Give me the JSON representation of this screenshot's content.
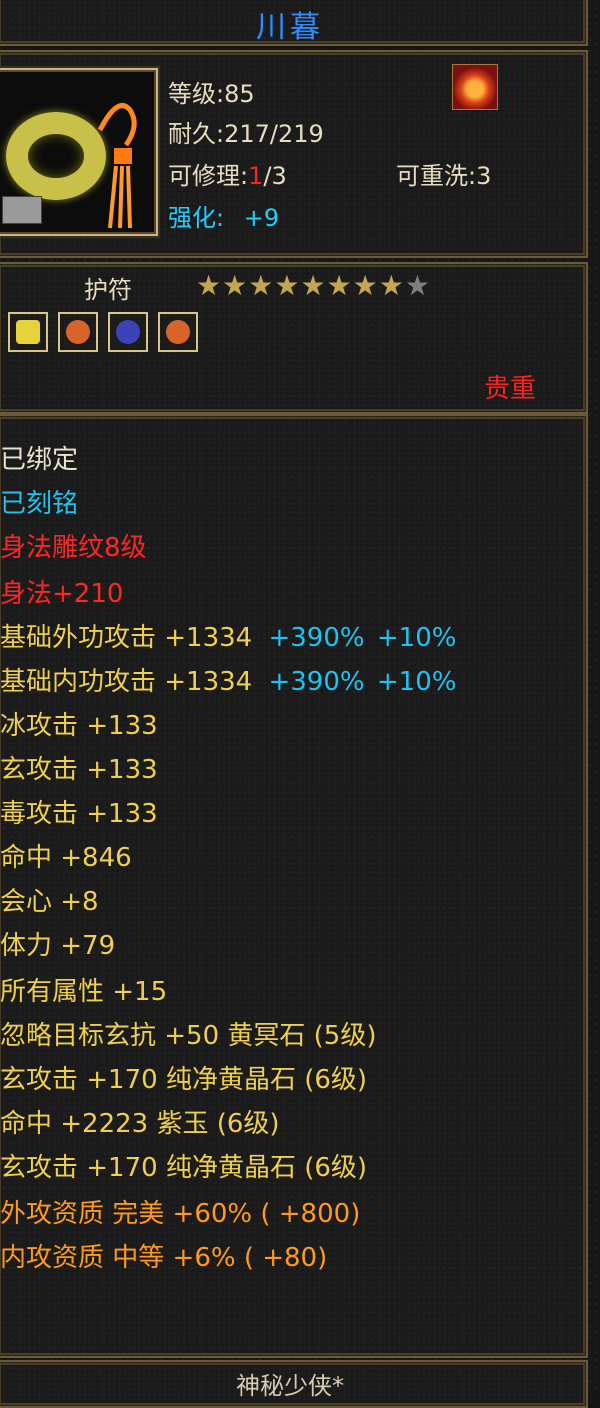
{
  "item": {
    "name": "川暮",
    "type": "护符",
    "rarity": "贵重",
    "level_label": "等级:85",
    "durability_label": "耐久:217/219",
    "repair_prefix": "可修理:",
    "repair_current": "1",
    "repair_suffix": "/3",
    "rewash_label": "可重洗:3",
    "enhance_label": "强化:",
    "enhance_value": "+9",
    "stars_total": 9,
    "stars_filled": 8
  },
  "gems": [
    {
      "name": "yellow-gem-icon",
      "color": "#e6d23a"
    },
    {
      "name": "amber-gem-icon",
      "color": "#d8642a"
    },
    {
      "name": "blue-gem-icon",
      "color": "#3a43b8"
    },
    {
      "name": "amber-gem-icon-2",
      "color": "#d8642a"
    }
  ],
  "stats": {
    "bound": "已绑定",
    "engraved": "已刻铭",
    "carving": "身法雕纹8级",
    "agility": "身法+210",
    "ext_attack": {
      "label": "基础外功攻击 +1334",
      "pct1": "+390%",
      "pct2": "+10%"
    },
    "int_attack": {
      "label": "基础内功攻击 +1334",
      "pct1": "+390%",
      "pct2": "+10%"
    },
    "ice": "冰攻击 +133",
    "xuan": "玄攻击 +133",
    "poison": "毒攻击 +133",
    "hit": "命中 +846",
    "crit": "会心 +8",
    "stamina": "体力 +79",
    "all_attr": "所有属性 +15",
    "ignore_xuan": "忽略目标玄抗 +50 黄冥石 (5级)",
    "xuan_gem1": "玄攻击 +170 纯净黄晶石 (6级)",
    "hit_gem": "命中 +2223 紫玉 (6级)",
    "xuan_gem2": "玄攻击 +170 纯净黄晶石 (6级)",
    "ext_quality": "外攻资质  完美 +60% ( +800)",
    "int_quality": "内攻资质  中等 +6% ( +80)"
  },
  "footer": "神秘少侠*"
}
